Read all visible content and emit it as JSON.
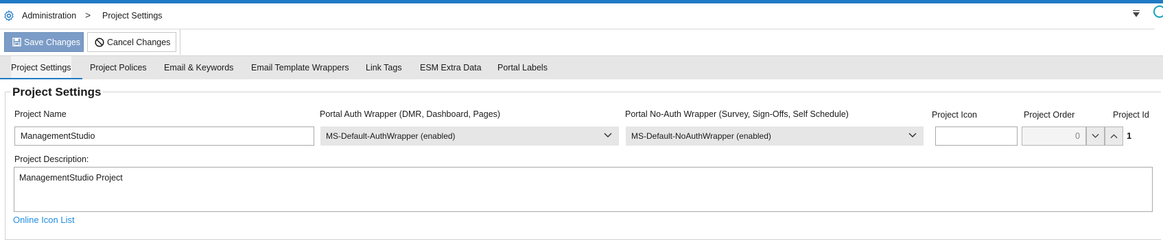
{
  "breadcrumb": {
    "root": "Administration",
    "separator": ">",
    "current": "Project Settings"
  },
  "toolbar": {
    "save_label": "Save Changes",
    "cancel_label": "Cancel Changes"
  },
  "tabs": [
    {
      "label": "Project Settings",
      "active": true
    },
    {
      "label": "Project Polices"
    },
    {
      "label": "Email & Keywords"
    },
    {
      "label": "Email Template Wrappers"
    },
    {
      "label": "Link Tags"
    },
    {
      "label": "ESM Extra Data"
    },
    {
      "label": "Portal Labels"
    }
  ],
  "section": {
    "title": "Project Settings",
    "project_name_label": "Project Name",
    "project_name_value": "ManagementStudio",
    "auth_wrapper_label": "Portal Auth Wrapper (DMR, Dashboard, Pages)",
    "auth_wrapper_value": "MS-Default-AuthWrapper (enabled)",
    "noauth_wrapper_label": "Portal No-Auth Wrapper (Survey, Sign-Offs, Self Schedule)",
    "noauth_wrapper_value": "MS-Default-NoAuthWrapper (enabled)",
    "project_icon_label": "Project Icon",
    "project_icon_value": "",
    "project_order_label": "Project Order",
    "project_order_value": "0",
    "project_id_label": "Project Id",
    "project_id_value": "1",
    "description_label": "Project Description:",
    "description_value": "ManagementStudio Project",
    "online_icon_link": "Online Icon List"
  },
  "colors": {
    "accent": "#1f7ac6",
    "save_button": "#7b9cc7",
    "link": "#1f8ce0",
    "tab_bar": "#e6e6e6"
  }
}
